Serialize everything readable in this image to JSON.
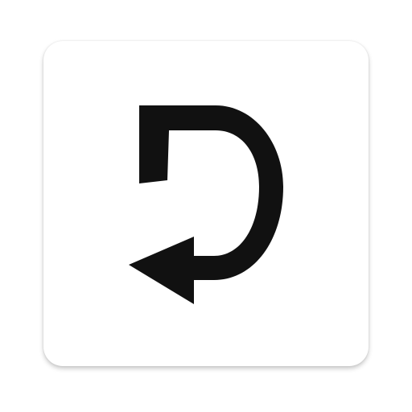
{
  "app_icon": {
    "background_color": "#ffffff",
    "glyph_color": "#111111",
    "icon": "d-return-arrow-logo-icon"
  }
}
